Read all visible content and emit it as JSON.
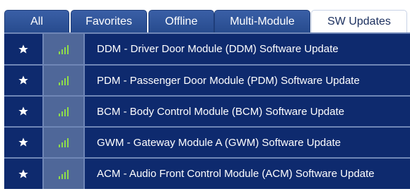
{
  "tabs": [
    {
      "label": "All",
      "active": false
    },
    {
      "label": "Favorites",
      "active": false
    },
    {
      "label": "Offline",
      "active": false
    },
    {
      "label": "Multi-Module",
      "active": false
    },
    {
      "label": "SW Updates",
      "active": true
    }
  ],
  "rows": [
    {
      "label": "DDM - Driver Door Module (DDM) Software Update",
      "star_icon": "star-icon",
      "signal_icon": "signal-bars-icon"
    },
    {
      "label": "PDM - Passenger Door Module (PDM) Software Update",
      "star_icon": "star-icon",
      "signal_icon": "signal-bars-icon"
    },
    {
      "label": "BCM - Body Control Module (BCM) Software Update",
      "star_icon": "star-icon",
      "signal_icon": "signal-bars-icon"
    },
    {
      "label": "GWM - Gateway Module A (GWM) Software Update",
      "star_icon": "star-icon",
      "signal_icon": "signal-bars-icon"
    },
    {
      "label": "ACM - Audio Front Control Module (ACM) Software Update",
      "star_icon": "star-icon",
      "signal_icon": "signal-bars-icon"
    }
  ],
  "colors": {
    "tab_bg": "#274b8e",
    "list_bg": "#0e2a6e",
    "signal_cell_bg": "#4f6799",
    "signal_bars": "#8edc4a",
    "divider": "#6f86b6"
  }
}
